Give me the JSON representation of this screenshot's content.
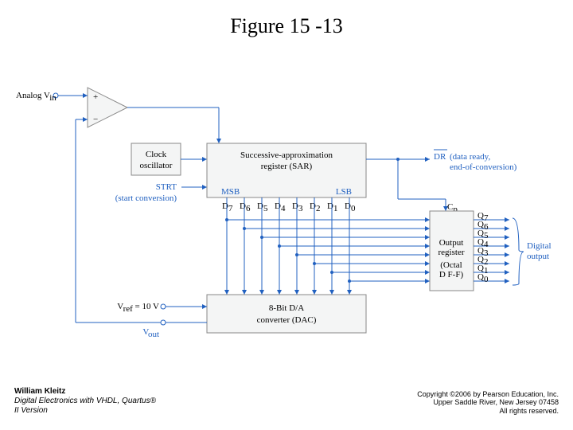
{
  "title": "Figure 15 -13",
  "labels": {
    "analog_vin": "Analog V",
    "analog_vin_sub": "in",
    "clock_osc_l1": "Clock",
    "clock_osc_l2": "oscillator",
    "strt_l1": "STRT",
    "strt_l2": "(start conversion)",
    "sar_l1": "Successive-approximation",
    "sar_l2": "register (SAR)",
    "msb": "MSB",
    "lsb": "LSB",
    "dr_bar": "DR",
    "dr_l2": "(data ready,",
    "dr_l3": "end-of-conversion)",
    "cp": "C",
    "cp_sub": "p",
    "out_reg_l1": "Output",
    "out_reg_l2": "register",
    "out_reg_l3": "(Octal",
    "out_reg_l4": "D F-F)",
    "digital_out_l1": "Digital",
    "digital_out_l2": "output",
    "vref": "V",
    "vref_sub": "ref",
    "vref_val": " = 10 V",
    "vout": "V",
    "vout_sub": "out",
    "dac_l1": "8-Bit D/A",
    "dac_l2": "converter (DAC)",
    "d_bits": [
      "D",
      "D",
      "D",
      "D",
      "D",
      "D",
      "D",
      "D"
    ],
    "d_subs": [
      "7",
      "6",
      "5",
      "4",
      "3",
      "2",
      "1",
      "0"
    ],
    "q_bits": [
      "Q",
      "Q",
      "Q",
      "Q",
      "Q",
      "Q",
      "Q",
      "Q"
    ],
    "q_subs": [
      "7",
      "6",
      "5",
      "4",
      "3",
      "2",
      "1",
      "0"
    ]
  },
  "footer": {
    "author": "William Kleitz",
    "book_l1": "Digital Electronics with VHDL, Quartus®",
    "book_l2": "II Version",
    "copy_l1": "Copyright ©2006 by Pearson Education, Inc.",
    "copy_l2": "Upper Saddle River, New Jersey 07458",
    "copy_l3": "All rights reserved."
  }
}
